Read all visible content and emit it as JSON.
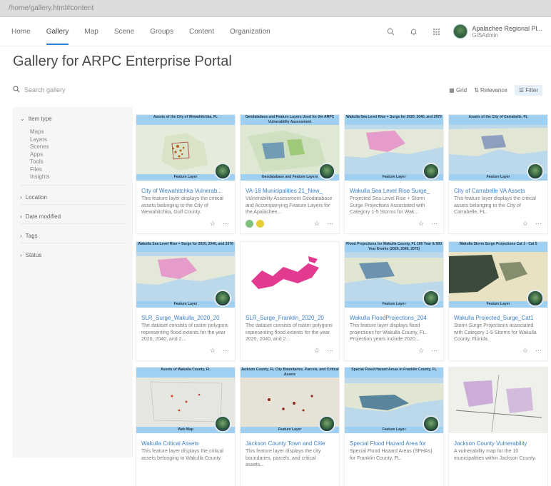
{
  "browser": {
    "url": "/home/gallery.html#content"
  },
  "nav": {
    "items": [
      "Home",
      "Gallery",
      "Map",
      "Scene",
      "Groups",
      "Content",
      "Organization"
    ],
    "active_index": 1,
    "icons": [
      "search-icon",
      "bell-icon",
      "apps-grid-icon"
    ],
    "user": {
      "name": "Apalachee Regional Pl...",
      "role": "GISAdmin"
    }
  },
  "page": {
    "title": "Gallery for ARPC Enterprise Portal"
  },
  "search": {
    "placeholder": "Search gallery"
  },
  "toolbar": {
    "grid_label": "Grid",
    "sort_label": "Relevance",
    "filter_label": "Filter"
  },
  "sidebar": {
    "facets": [
      {
        "label": "Item type",
        "expanded": true,
        "items": [
          "Maps",
          "Layers",
          "Scenes",
          "Apps",
          "Tools",
          "Files",
          "Insights"
        ]
      },
      {
        "label": "Location",
        "expanded": false,
        "items": []
      },
      {
        "label": "Date modified",
        "expanded": false,
        "items": []
      },
      {
        "label": "Tags",
        "expanded": false,
        "items": []
      },
      {
        "label": "Status",
        "expanded": false,
        "items": []
      }
    ]
  },
  "cards": [
    {
      "title": "City of Wewahitchka Vulnerab...",
      "desc": "This feature layer displays the critical assets belonging to the City of Wewahitchka, Gulf County.",
      "banner": "Assets of the City of Wewahitchka, FL",
      "footer": "Feature Layer"
    },
    {
      "title": "VA-18 Municipalities 21_New_",
      "desc": "Vulnerability Assessment Geodatabase and Accompanying Feature Layers for the Apalachee...",
      "banner": "Geodatabase and Feature Layers Used for the ARPC Vulnerability Assessment",
      "footer": "Geodatabase and Feature Layers"
    },
    {
      "title": "Wakulla Sea Level Rise Surge_",
      "desc": "Projected Sea Level Rise + Storm Surge Projections Associated with Category 1-5 Storms for Wak...",
      "banner": "Wakulla Sea Level Rise + Surge for 2020, 2040, and 2070",
      "footer": "Feature Layer"
    },
    {
      "title": "City of Carrabelle VA Assets",
      "desc": "This feature layer displays the critical assets belonging to the City of Carrabelle, FL.",
      "banner": "Assets of the City of Carrabelle, FL",
      "footer": "Feature Layer"
    },
    {
      "title": "SLR_Surge_Wakulla_2020_20",
      "desc": "The dataset consists of raster polygons representing flood extents for the year 2020, 2040, and 2...",
      "banner": "Wakulla Sea Level Rise + Surge for 2020, 2040, and 2070",
      "footer": "Feature Layer"
    },
    {
      "title": "SLR_Surge_Franklin_2020_20",
      "desc": "The dataset consists of raster polygons representing flood extents for the year 2020, 2040, and 2...",
      "banner": "",
      "footer": ""
    },
    {
      "title": "Wakulla FloodProjections_204",
      "desc": "This feature layer displays flood projections for Wakulla County, FL. Projection years include 2020...",
      "banner": "Flood Projections for Wakulla County, FL 100 Year & 500 Year Events (2020, 2040, 2070)",
      "footer": "Feature Layer"
    },
    {
      "title": "Wakulla Projected_Surge_Cat1",
      "desc": "Storm Surge Projections associated with Category 1-5 Storms for Wakulla County, Florida.",
      "banner": "Wakulla Storm Surge Projections Cat 1 - Cat 5",
      "footer": "Feature Layer"
    },
    {
      "title": "Wakulla Critical Assets",
      "desc": "This feature layer displays the critical assets belonging to Wakulla County.",
      "banner": "Assets of Wakulla County, FL",
      "footer": "Web Map"
    },
    {
      "title": "Jackson County Town and Citie",
      "desc": "This feature layer displays the city boundaries, parcels, and critical assets...",
      "banner": "Jackson County, FL City Boundaries, Parcels, and Critical Assets",
      "footer": "Feature Layer"
    },
    {
      "title": "Special Flood Hazard Area for",
      "desc": "Special Flood Hazard Areas (SFHAs) for Franklin County, FL.",
      "banner": "Special Flood Hazard Areas in Franklin County, FL",
      "footer": "Feature Layer"
    },
    {
      "title": "Jackson County Vulnerability",
      "desc": "A vulnerability map for the 10 municipalities within Jackson County.",
      "banner": "",
      "footer": ""
    }
  ],
  "colors": {
    "accent": "#2f7fcf",
    "link": "#3f7fc1",
    "banner": "#9fd0f2",
    "sidebar_bg": "#f6f6f6"
  }
}
